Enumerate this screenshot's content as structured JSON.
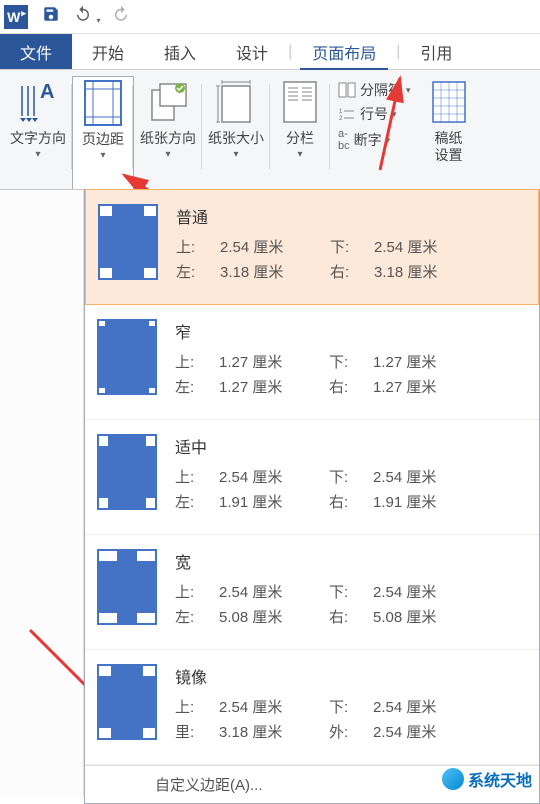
{
  "titlebar": {
    "app_letter": "W"
  },
  "tabs": {
    "file": "文件",
    "home": "开始",
    "insert": "插入",
    "design": "设计",
    "layout": "页面布局",
    "references": "引用"
  },
  "ribbon": {
    "text_direction": "文字方向",
    "margins": "页边距",
    "orientation": "纸张方向",
    "size": "纸张大小",
    "columns": "分栏",
    "breaks": "分隔符",
    "line_numbers": "行号",
    "hyphenation": "断字",
    "manuscript": "稿纸\n设置"
  },
  "margins_dropdown": {
    "options": [
      {
        "name": "普通",
        "preview": "normal",
        "top_label": "上:",
        "top_val": "2.54 厘米",
        "bottom_label": "下:",
        "bottom_val": "2.54 厘米",
        "left_label": "左:",
        "left_val": "3.18 厘米",
        "right_label": "右:",
        "right_val": "3.18 厘米"
      },
      {
        "name": "窄",
        "preview": "narrow",
        "top_label": "上:",
        "top_val": "1.27 厘米",
        "bottom_label": "下:",
        "bottom_val": "1.27 厘米",
        "left_label": "左:",
        "left_val": "1.27 厘米",
        "right_label": "右:",
        "right_val": "1.27 厘米"
      },
      {
        "name": "适中",
        "preview": "moderate",
        "top_label": "上:",
        "top_val": "2.54 厘米",
        "bottom_label": "下:",
        "bottom_val": "2.54 厘米",
        "left_label": "左:",
        "left_val": "1.91 厘米",
        "right_label": "右:",
        "right_val": "1.91 厘米"
      },
      {
        "name": "宽",
        "preview": "wide",
        "top_label": "上:",
        "top_val": "2.54 厘米",
        "bottom_label": "下:",
        "bottom_val": "2.54 厘米",
        "left_label": "左:",
        "left_val": "5.08 厘米",
        "right_label": "右:",
        "right_val": "5.08 厘米"
      },
      {
        "name": "镜像",
        "preview": "mirror",
        "top_label": "上:",
        "top_val": "2.54 厘米",
        "bottom_label": "下:",
        "bottom_val": "2.54 厘米",
        "left_label": "里:",
        "left_val": "3.18 厘米",
        "right_label": "外:",
        "right_val": "2.54 厘米"
      }
    ],
    "custom": "自定义边距(A)..."
  },
  "watermark": {
    "text": "系统天地"
  }
}
